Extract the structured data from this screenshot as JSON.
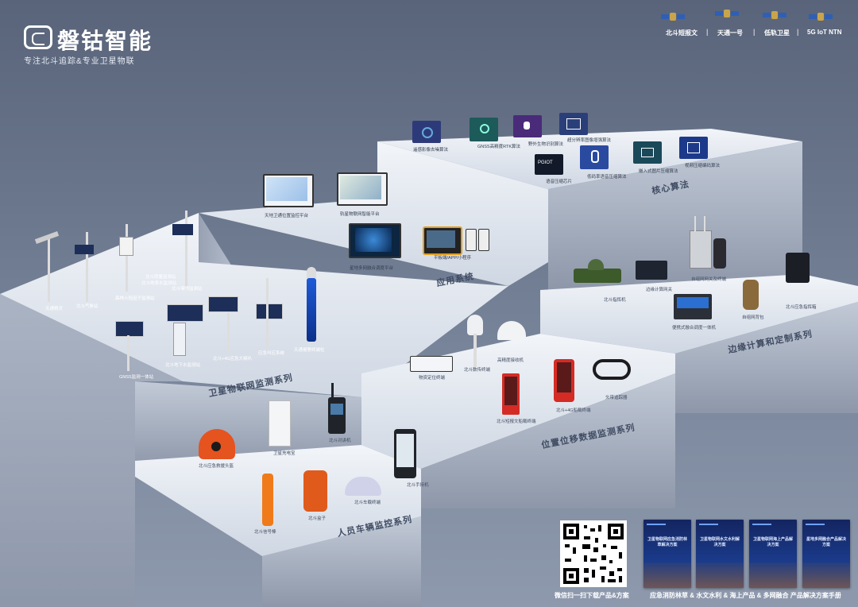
{
  "brand": {
    "name": "磐钴智能",
    "slogan": "专注北斗追踪&专业卫星物联",
    "logo_icon": "brand-logo-icon"
  },
  "top_nav": {
    "items": [
      "北斗短报文",
      "天通一号",
      "低轨卫星",
      "5G IoT NTN"
    ],
    "separator": "|"
  },
  "sections": {
    "core": "核心算法",
    "app": "应用系统",
    "iot": "卫星物联网监测系列",
    "edge": "边缘计算和定制系列",
    "position": "位置位移数据监测系列",
    "people": "人员车辆监控系列"
  },
  "core_items": [
    "遥感影像去噪算法",
    "GNSS高精度RTK算法",
    "野外生物识别算法",
    "超分辨率图像增强算法",
    "语音压缩芯片",
    "低码率语音压缩算法",
    "嵌入式图片压缩算法",
    "视频压缩编码算法"
  ],
  "core_chip_label": "PGIOT",
  "app_items": [
    "天地卫通位置监控平台",
    "轨星物联网智能平台",
    "星地多网融合调度平台",
    "平板端/APP/小程序"
  ],
  "iot_items": [
    "天通精灵",
    "北斗气象站",
    "森林火险因子监测站",
    "北斗墒情监测站",
    "北斗地表水监测站",
    "北斗雨量监测站",
    "GNSS监测一体站",
    "北斗地下水监测站",
    "北斗+4G应急大喇叭",
    "应急叫应系统",
    "天通报警终端柱"
  ],
  "edge_items": [
    "北斗指挥机",
    "边缘计算网关",
    "自组网网关及终端",
    "便携式融合调度一体机",
    "自组网背包",
    "北斗应急指挥箱"
  ],
  "position_items": [
    "物资定位终端",
    "北斗数传终端",
    "高精度接收机",
    "北斗短报文船载终端",
    "北斗+4G船载终端",
    "头带追踪器"
  ],
  "people_items": [
    "北斗应急救援头盔",
    "卫星充电宝",
    "北斗对讲机",
    "北斗手持机",
    "北斗信号棒",
    "北斗盒子",
    "北斗车载终端"
  ],
  "qr": {
    "caption": "微信扫一扫下载产品&方案"
  },
  "books": {
    "titles": [
      "卫星物联网应急消防林草解决方案",
      "卫星物联网水文水利解决方案",
      "卫星物联网海上产品解决方案",
      "星地多网融合产品解决方案"
    ],
    "caption": "应急消防林草 & 水文水利 & 海上产品 & 多网融合  产品解决方案手册"
  },
  "colors": {
    "accent": "#1e88e5",
    "step_top": "#dfe6f0",
    "step_face": "#a9b3c4"
  }
}
